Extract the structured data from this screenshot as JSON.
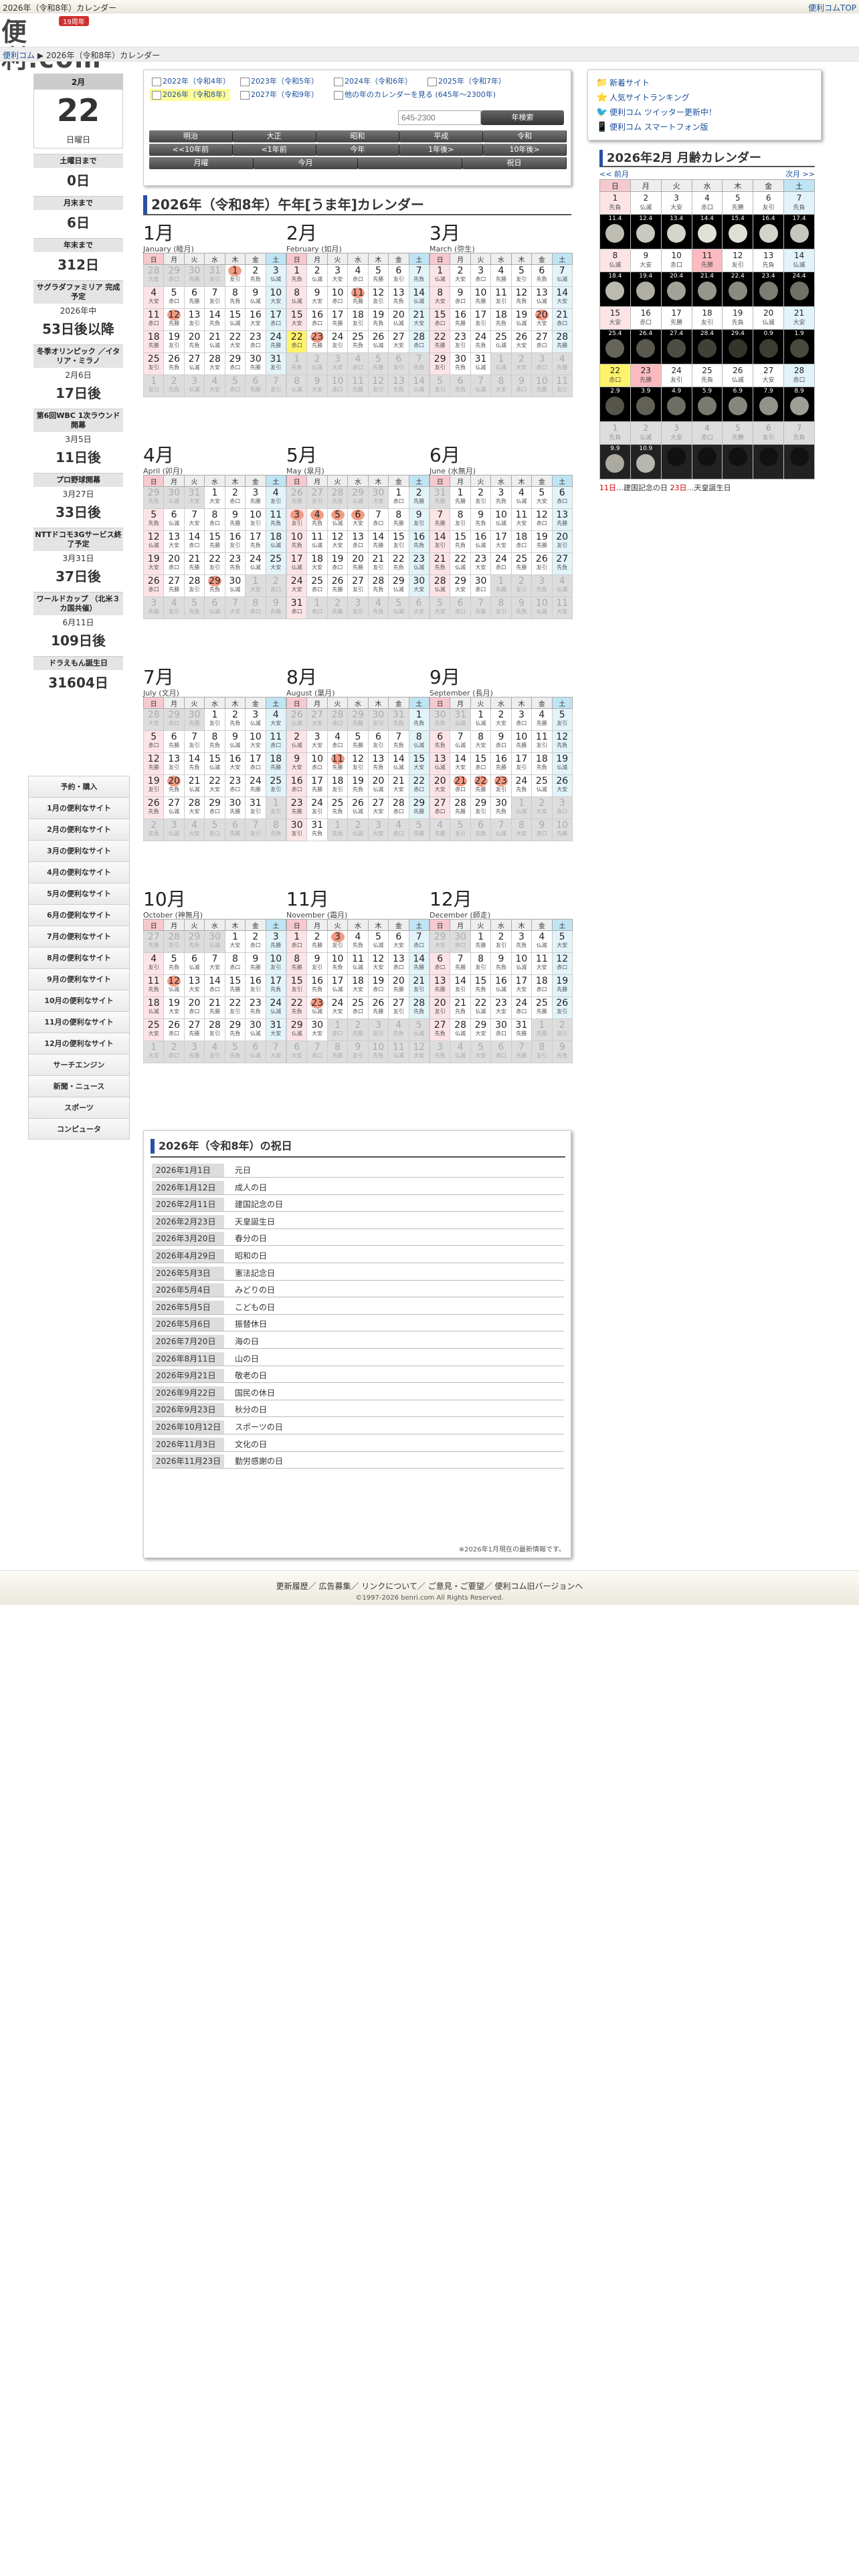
{
  "top": {
    "title": "2026年（令和8年）カレンダー",
    "top_link": "便利コムTOP"
  },
  "logo": {
    "text": "便利.com",
    "badge": "19周年"
  },
  "breadcrumb": {
    "home": "便利コム",
    "sep": "▶",
    "current": "2026年（令和8年）カレンダー"
  },
  "today": {
    "month": "2月",
    "day": "22",
    "weekday": "日曜日"
  },
  "countdowns": [
    {
      "label": "土曜日まで",
      "sub": "",
      "value": "0日"
    },
    {
      "label": "月末まで",
      "sub": "",
      "value": "6日"
    },
    {
      "label": "年末まで",
      "sub": "",
      "value": "312日"
    },
    {
      "label": "サグラダファミリア 完成予定",
      "sub": "2026年中",
      "value": "53日後以降"
    },
    {
      "label": "冬季オリンピック ／イタリア・ミラノ",
      "sub": "2月6日",
      "value": "17日後"
    },
    {
      "label": "第6回WBC 1次ラウンド開幕",
      "sub": "3月5日",
      "value": "11日後"
    },
    {
      "label": "プロ野球開幕",
      "sub": "3月27日",
      "value": "33日後"
    },
    {
      "label": "NTTドコモ3Gサービス終了予定",
      "sub": "3月31日",
      "value": "37日後"
    },
    {
      "label": "ワールドカップ （北米３カ国共催）",
      "sub": "6月11日",
      "value": "109日後"
    },
    {
      "label": "ドラえもん誕生日",
      "sub": "",
      "value": "31604日"
    }
  ],
  "menu": [
    "予約・購入",
    "1月の便利なサイト",
    "2月の便利なサイト",
    "3月の便利なサイト",
    "4月の便利なサイト",
    "5月の便利なサイト",
    "6月の便利なサイト",
    "7月の便利なサイト",
    "8月の便利なサイト",
    "9月の便利なサイト",
    "10月の便利なサイト",
    "11月の便利なサイト",
    "12月の便利なサイト",
    "サーチエンジン",
    "新聞・ニュース",
    "スポーツ",
    "コンピュータ"
  ],
  "year_links": [
    "2022年（令和4年）",
    "2023年（令和5年）",
    "2024年（令和6年）",
    "2025年（令和7年）",
    "2026年（令和8年）",
    "2027年（令和9年）",
    "他の年のカレンダーを見る (645年〜2300年)"
  ],
  "search": {
    "placeholder": "645-2300",
    "button": "年検索"
  },
  "era_buttons": [
    "明治",
    "大正",
    "昭和",
    "平成",
    "令和"
  ],
  "nav_buttons": [
    "<<10年前",
    "<1年前",
    "今年",
    "1年後>",
    "10年後>"
  ],
  "today_buttons": [
    "月曜",
    "今月",
    "",
    "祝日"
  ],
  "page_title": "2026年（令和8年）午年[うま年]カレンダー",
  "weekdays": [
    "日",
    "月",
    "火",
    "水",
    "木",
    "金",
    "土"
  ],
  "months": [
    {
      "m": "1月",
      "e": "January (睦月)",
      "start": 4,
      "len": 31,
      "prev": 31,
      "hol": [
        1,
        12
      ]
    },
    {
      "m": "2月",
      "e": "February (如月)",
      "start": 0,
      "len": 28,
      "prev": 31,
      "hol": [
        11,
        23
      ]
    },
    {
      "m": "3月",
      "e": "March (弥生)",
      "start": 0,
      "len": 31,
      "prev": 28,
      "hol": [
        20
      ]
    },
    {
      "m": "4月",
      "e": "April (卯月)",
      "start": 3,
      "len": 30,
      "prev": 31,
      "hol": [
        29
      ]
    },
    {
      "m": "5月",
      "e": "May (皐月)",
      "start": 5,
      "len": 31,
      "prev": 30,
      "hol": [
        3,
        4,
        5,
        6
      ]
    },
    {
      "m": "6月",
      "e": "June (水無月)",
      "start": 1,
      "len": 30,
      "prev": 31,
      "hol": []
    },
    {
      "m": "7月",
      "e": "July (文月)",
      "start": 3,
      "len": 31,
      "prev": 30,
      "hol": [
        20
      ]
    },
    {
      "m": "8月",
      "e": "August (葉月)",
      "start": 6,
      "len": 31,
      "prev": 31,
      "hol": [
        11
      ]
    },
    {
      "m": "9月",
      "e": "September (長月)",
      "start": 2,
      "len": 30,
      "prev": 31,
      "hol": [
        21,
        22,
        23
      ]
    },
    {
      "m": "10月",
      "e": "October (神無月)",
      "start": 4,
      "len": 31,
      "prev": 30,
      "hol": [
        12
      ]
    },
    {
      "m": "11月",
      "e": "November (霜月)",
      "start": 0,
      "len": 30,
      "prev": 31,
      "hol": [
        3,
        23
      ]
    },
    {
      "m": "12月",
      "e": "December (師走)",
      "start": 2,
      "len": 31,
      "prev": 30,
      "hol": []
    }
  ],
  "rokuyo": [
    "先勝",
    "友引",
    "先負",
    "仏滅",
    "大安",
    "赤口"
  ],
  "holidays_title": "2026年（令和8年）の祝日",
  "holidays": [
    {
      "d": "2026年1月1日",
      "n": "元日"
    },
    {
      "d": "2026年1月12日",
      "n": "成人の日"
    },
    {
      "d": "2026年2月11日",
      "n": "建国記念の日"
    },
    {
      "d": "2026年2月23日",
      "n": "天皇誕生日"
    },
    {
      "d": "2026年3月20日",
      "n": "春分の日"
    },
    {
      "d": "2026年4月29日",
      "n": "昭和の日"
    },
    {
      "d": "2026年5月3日",
      "n": "憲法記念日"
    },
    {
      "d": "2026年5月4日",
      "n": "みどりの日"
    },
    {
      "d": "2026年5月5日",
      "n": "こどもの日"
    },
    {
      "d": "2026年5月6日",
      "n": "振替休日"
    },
    {
      "d": "2026年7月20日",
      "n": "海の日"
    },
    {
      "d": "2026年8月11日",
      "n": "山の日"
    },
    {
      "d": "2026年9月21日",
      "n": "敬老の日"
    },
    {
      "d": "2026年9月22日",
      "n": "国民の休日"
    },
    {
      "d": "2026年9月23日",
      "n": "秋分の日"
    },
    {
      "d": "2026年10月12日",
      "n": "スポーツの日"
    },
    {
      "d": "2026年11月3日",
      "n": "文化の日"
    },
    {
      "d": "2026年11月23日",
      "n": "勤労感謝の日"
    }
  ],
  "holidays_note": "※2026年1月現在の最新情報です。",
  "right_links": [
    "新着サイト",
    "人気サイトランキング",
    "便利コム ツイッター更新中！",
    "便利コム スマートフォン版"
  ],
  "moon": {
    "title": "2026年2月 月齢カレンダー",
    "prev": "<< 前月",
    "next": "次月 >>",
    "ages": [
      "11.4",
      "12.4",
      "13.4",
      "14.4",
      "15.4",
      "16.4",
      "17.4",
      "18.4",
      "19.4",
      "20.4",
      "21.4",
      "22.4",
      "23.4",
      "24.4",
      "25.4",
      "26.4",
      "27.4",
      "28.4",
      "29.4",
      "0.9",
      "1.9",
      "2.9",
      "3.9",
      "4.9",
      "5.9",
      "6.9",
      "7.9",
      "8.9",
      "9.9",
      "10.9"
    ],
    "foot_red1": "11日",
    "foot_t1": "…建国記念の日 ",
    "foot_red2": "23日",
    "foot_t2": "…天皇誕生日"
  },
  "footer": {
    "links": "更新履歴／ 広告募集／ リンクについて／ ご意見・ご要望／ 便利コム旧バージョンへ",
    "copy": "©1997-2026 benri.com All Rights Reserved."
  }
}
